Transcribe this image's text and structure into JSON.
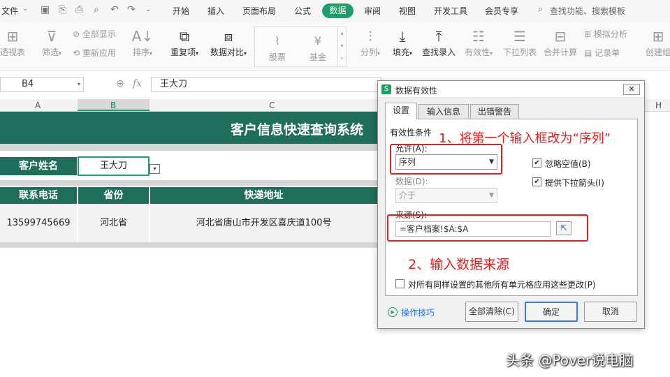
{
  "menubar": {
    "file": "文件",
    "tabs": [
      "开始",
      "插入",
      "页面布局",
      "公式",
      "数据",
      "审阅",
      "视图",
      "开发工具",
      "会员专享"
    ],
    "active_tab": "数据",
    "search": "查找功能、搜索模板"
  },
  "ribbon": {
    "pivot": "透视表",
    "filter": "筛选",
    "show_all": "全部显示",
    "reapply": "重新应用",
    "sort": "排序",
    "duplicates": "重复项",
    "compare": "数据对比",
    "stock": "股票",
    "fund": "基金",
    "split": "分列",
    "fill": "填充",
    "lookup_entry": "查找录入",
    "validity": "有效性",
    "dropdown_list": "下拉列表",
    "merge_calc": "合并计算",
    "simulate": "模拟分析",
    "record": "记录单",
    "create_group": "创建组"
  },
  "formula_bar": {
    "cell_ref": "B4",
    "fx": "fx",
    "value": "王大刀"
  },
  "columns": [
    "A",
    "B",
    "C",
    "H"
  ],
  "sheet": {
    "title": "客户信息快速查询系统",
    "name_label": "客户姓名",
    "name_value": "王大刀",
    "headers": [
      "联系电话",
      "省份",
      "快递地址"
    ],
    "row": [
      "13599745669",
      "河北省",
      "河北省唐山市开发区喜庆道100号"
    ]
  },
  "dialog": {
    "title": "数据有效性",
    "tabs": [
      "设置",
      "输入信息",
      "出错警告"
    ],
    "group_label": "有效性条件",
    "allow_label": "允许(A):",
    "allow_value": "序列",
    "data_label": "数据(D):",
    "data_value": "介于",
    "ignore_blank": "忽略空值(B)",
    "show_dropdown": "提供下拉箭头(I)",
    "source_label": "来源(S):",
    "source_value": "=客户档案!$A:$A",
    "apply_all": "对所有同样设置的其他所有单元格应用这些更改(P)",
    "tips": "操作技巧",
    "clear_all": "全部清除(C)",
    "ok": "确定",
    "cancel": "取消"
  },
  "annotations": {
    "note1": "1、将第一个输入框改为“序列”",
    "note2": "2、输入数据来源"
  },
  "watermark": "头条 @Pover说电脑"
}
